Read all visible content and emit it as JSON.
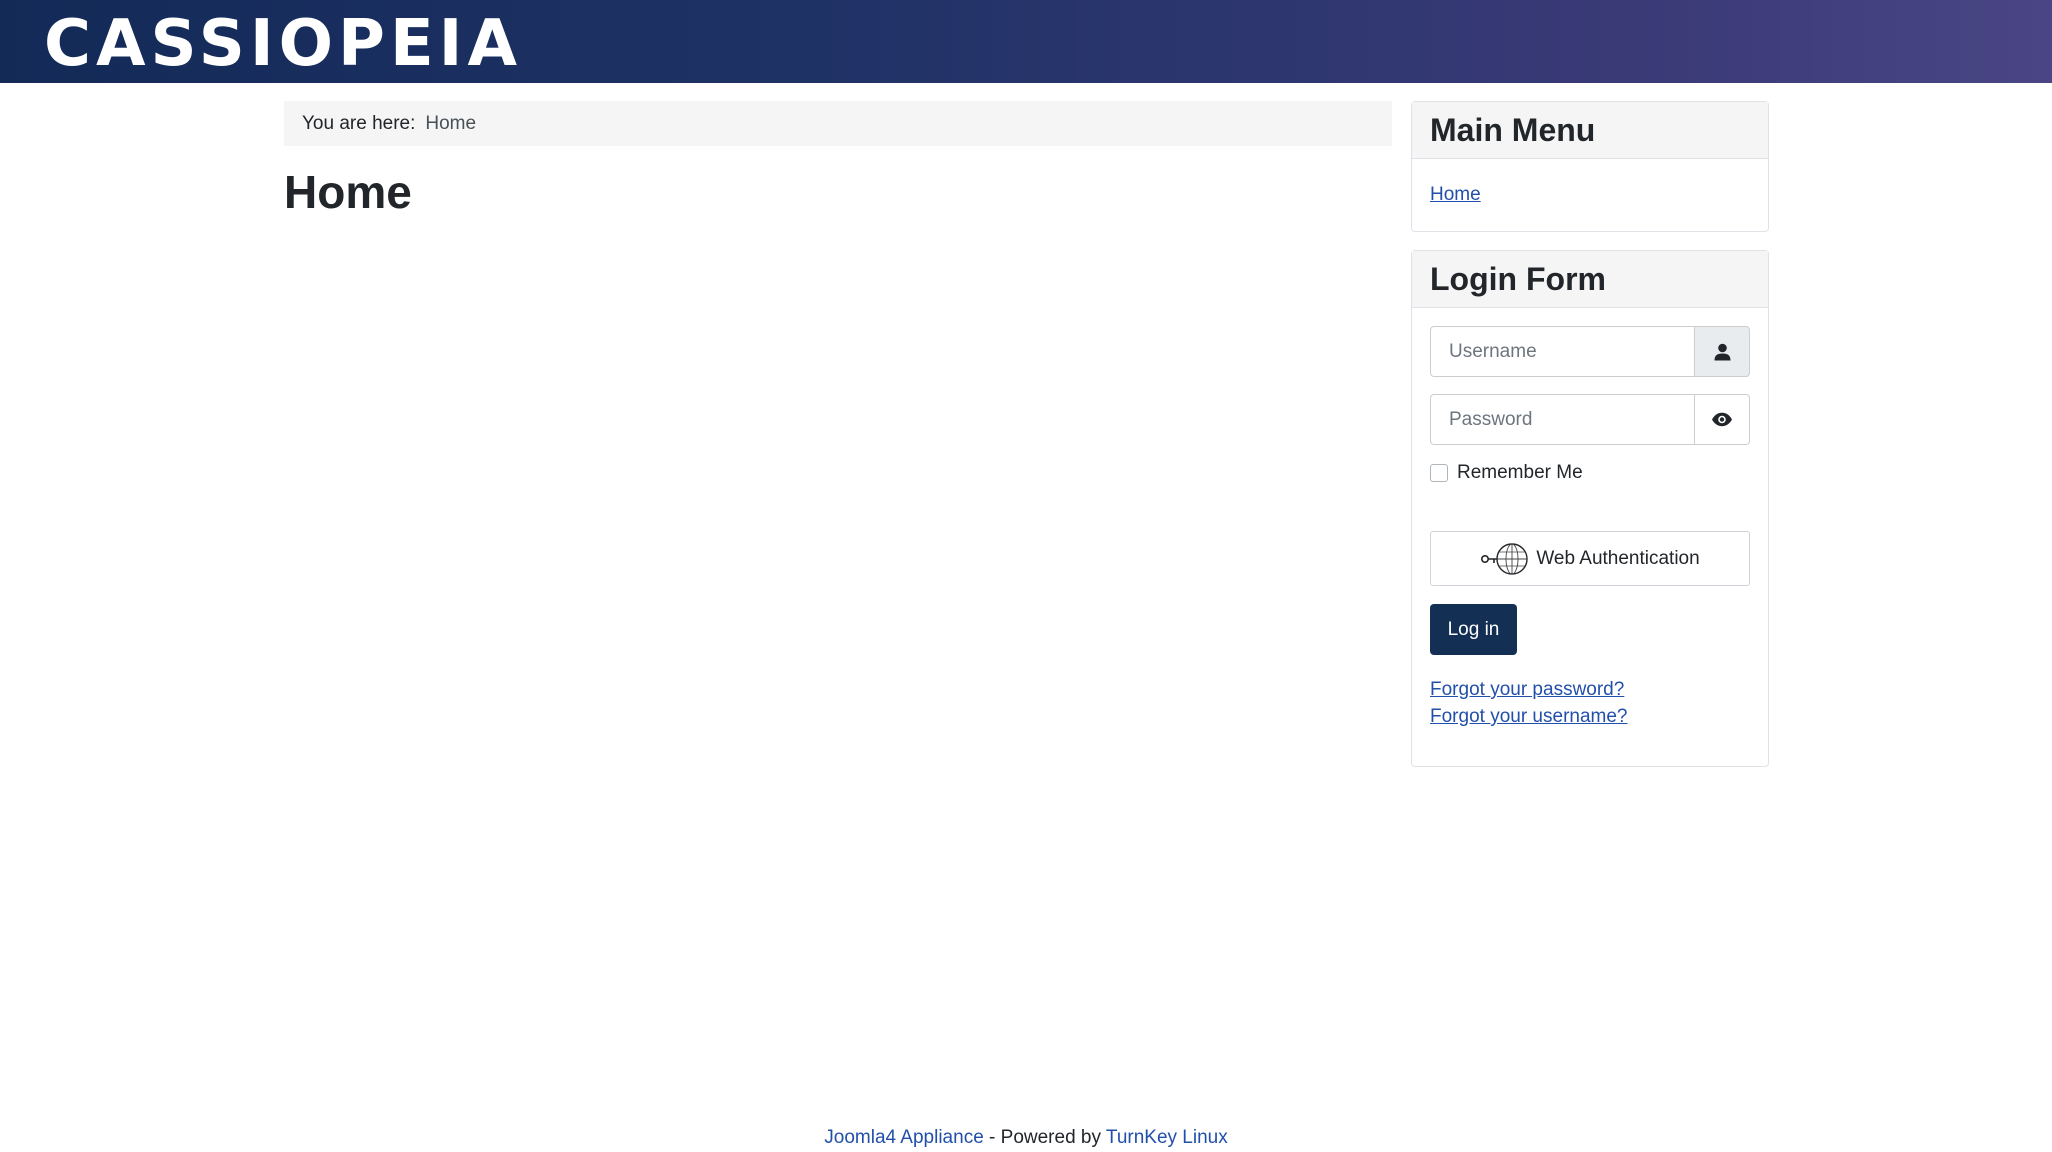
{
  "header": {
    "brand": "CASSIOPEIA"
  },
  "breadcrumb": {
    "label": "You are here:",
    "current": "Home"
  },
  "page": {
    "title": "Home"
  },
  "main_menu": {
    "title": "Main Menu",
    "items": [
      {
        "label": "Home"
      }
    ]
  },
  "login_form": {
    "title": "Login Form",
    "username_placeholder": "Username",
    "password_placeholder": "Password",
    "remember_label": "Remember Me",
    "webauthn_label": "Web Authentication",
    "login_label": "Log in",
    "forgot_password": "Forgot your password?",
    "forgot_username": "Forgot your username?",
    "icons": {
      "username": "user-icon",
      "password": "eye-icon",
      "webauthn": "key-globe-icon"
    }
  },
  "footer": {
    "appliance_link": "Joomla4 Appliance",
    "separator": " - Powered by ",
    "turnkey_link": "TurnKey Linux"
  },
  "colors": {
    "header_gradient_start": "#132a57",
    "header_gradient_end": "#4a4685",
    "link": "#224faa",
    "primary_button": "#132f53"
  }
}
